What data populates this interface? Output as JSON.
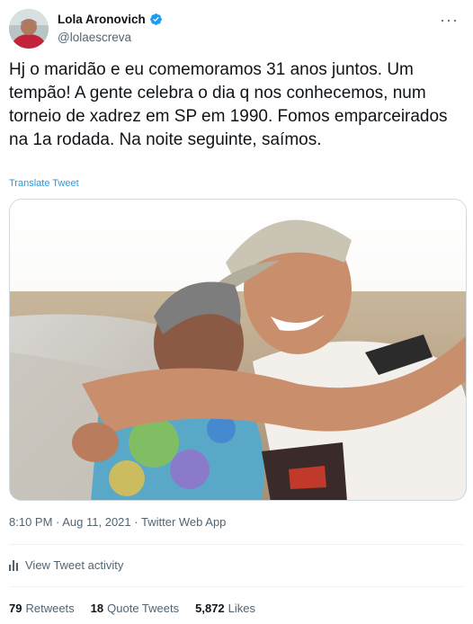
{
  "author": {
    "display_name": "Lola Aronovich",
    "handle": "@lolaescreva",
    "verified": true,
    "avatar_icon": "user-avatar"
  },
  "menu": {
    "more_label": "···"
  },
  "tweet": {
    "text": "Hj o maridão e eu comemoramos 31 anos juntos. Um tempão! A gente celebra o dia q nos conhecemos, num torneio de xadrez em SP em 1990. Fomos emparceirados na 1a rodada. Na noite seguinte, saímos.",
    "translate_label": "Translate Tweet"
  },
  "meta": {
    "time": "8:10 PM",
    "separator": " · ",
    "date": "Aug 11, 2021",
    "app": "Twitter Web App"
  },
  "activity": {
    "label": "View Tweet activity",
    "icon": "analytics-icon"
  },
  "stats": {
    "retweets_count": "79",
    "retweets_label": "Retweets",
    "quotes_count": "18",
    "quotes_label": "Quote Tweets",
    "likes_count": "5,872",
    "likes_label": "Likes"
  },
  "colors": {
    "link": "#1d9bf0",
    "secondary_text": "#536471",
    "primary_text": "#0f1419",
    "verified_badge": "#1d9bf0",
    "divider": "#eff3f4"
  }
}
